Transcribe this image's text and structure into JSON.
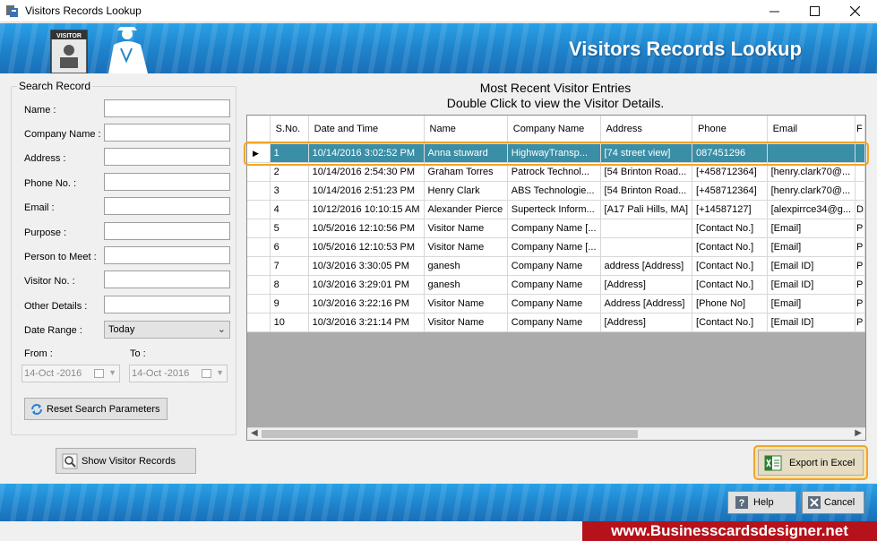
{
  "window": {
    "title": "Visitors Records Lookup"
  },
  "banner": {
    "heading": "Visitors Records Lookup",
    "badge_text": "VISITOR"
  },
  "search": {
    "group_title": "Search Record",
    "fields": [
      {
        "label": "Name :",
        "value": ""
      },
      {
        "label": "Company Name :",
        "value": ""
      },
      {
        "label": "Address :",
        "value": ""
      },
      {
        "label": "Phone No. :",
        "value": ""
      },
      {
        "label": "Email :",
        "value": ""
      },
      {
        "label": "Purpose :",
        "value": ""
      },
      {
        "label": "Person to Meet :",
        "value": ""
      },
      {
        "label": "Visitor No. :",
        "value": ""
      },
      {
        "label": "Other Details :",
        "value": ""
      }
    ],
    "date_range": {
      "label": "Date Range :",
      "value": "Today"
    },
    "from": {
      "label": "From :",
      "value": "14-Oct -2016"
    },
    "to": {
      "label": "To :",
      "value": "14-Oct -2016"
    },
    "reset_label": "Reset Search Parameters",
    "show_label": "Show Visitor Records"
  },
  "entries": {
    "heading_line1": "Most Recent Visitor Entries",
    "heading_line2": "Double Click to view the Visitor Details.",
    "columns": [
      "S.No.",
      "Date and Time",
      "Name",
      "Company Name",
      "Address",
      "Phone",
      "Email",
      "F"
    ],
    "rows": [
      [
        "1",
        "10/14/2016 3:02:52 PM",
        "Anna stuward",
        "HighwayTransp...",
        "[74 street view]",
        "087451296",
        "",
        ""
      ],
      [
        "2",
        "10/14/2016 2:54:30 PM",
        "Graham Torres",
        "Patrock Technol...",
        "[54 Brinton Road...",
        "[+458712364]",
        "[henry.clark70@...",
        ""
      ],
      [
        "3",
        "10/14/2016 2:51:23 PM",
        "Henry Clark",
        "ABS Technologie...",
        "[54 Brinton Road...",
        "[+458712364]",
        "[henry.clark70@...",
        ""
      ],
      [
        "4",
        "10/12/2016 10:10:15 AM",
        "Alexander Pierce",
        "Superteck Inform...",
        "[A17 Pali Hills, MA]",
        "[+14587127]",
        "[alexpirrce34@g...",
        "D"
      ],
      [
        "5",
        "10/5/2016 12:10:56 PM",
        "Visitor Name",
        "Company Name [...",
        "",
        "[Contact No.]",
        "[Email]",
        "P"
      ],
      [
        "6",
        "10/5/2016 12:10:53 PM",
        "Visitor Name",
        "Company Name [...",
        "",
        "[Contact No.]",
        "[Email]",
        "P"
      ],
      [
        "7",
        "10/3/2016 3:30:05 PM",
        "ganesh",
        "Company Name",
        "address [Address]",
        "[Contact No.]",
        "[Email ID]",
        "P"
      ],
      [
        "8",
        "10/3/2016 3:29:01 PM",
        "ganesh",
        "Company Name",
        "[Address]",
        "[Contact No.]",
        "[Email ID]",
        "P"
      ],
      [
        "9",
        "10/3/2016 3:22:16 PM",
        "Visitor Name",
        "Company Name",
        "Address [Address]",
        "[Phone No]",
        "[Email]",
        "P"
      ],
      [
        "10",
        "10/3/2016 3:21:14 PM",
        "Visitor Name",
        "Company Name",
        "[Address]",
        "[Contact No.]",
        "[Email ID]",
        "P"
      ]
    ],
    "selected_row": 0
  },
  "actions": {
    "export_label": "Export in Excel",
    "help_label": "Help",
    "cancel_label": "Cancel"
  },
  "footer": {
    "website": "www.Businesscardsdesigner.net"
  },
  "colors": {
    "selection": "#3a8ea5",
    "highlight_ring": "#f1a526",
    "banner": "#1f86cf",
    "website_bg": "#b5121b"
  }
}
